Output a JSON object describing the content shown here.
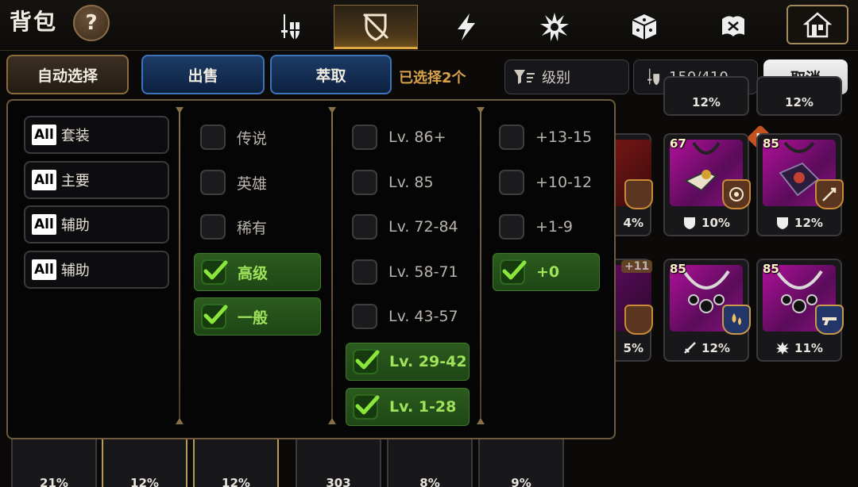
{
  "header": {
    "title": "背包",
    "help_label": "?",
    "tabs": [
      {
        "icon": "sword-shield-icon",
        "active": false
      },
      {
        "icon": "crossed-shield-icon",
        "active": true
      },
      {
        "icon": "lightning-icon",
        "active": false
      },
      {
        "icon": "burst-icon",
        "active": false
      },
      {
        "icon": "dice-icon",
        "active": false
      },
      {
        "icon": "artifact-icon",
        "active": false
      }
    ],
    "home_icon": "house-icon"
  },
  "toolbar": {
    "auto_select": "自动选择",
    "sell": "出售",
    "extract": "萃取",
    "selected_count": "已选择2个",
    "sort_label": "级别",
    "capacity": "150/410",
    "cancel": "取消"
  },
  "filters": {
    "sets": [
      {
        "tag": "All",
        "label": "套装"
      },
      {
        "tag": "All",
        "label": "主要"
      },
      {
        "tag": "All",
        "label": "辅助"
      },
      {
        "tag": "All",
        "label": "辅助"
      }
    ],
    "rarity": [
      {
        "label": "传说",
        "checked": false
      },
      {
        "label": "英雄",
        "checked": false
      },
      {
        "label": "稀有",
        "checked": false
      },
      {
        "label": "高级",
        "checked": true
      },
      {
        "label": "一般",
        "checked": true
      }
    ],
    "level": [
      {
        "label": "Lv. 86+",
        "checked": false
      },
      {
        "label": "Lv. 85",
        "checked": false
      },
      {
        "label": "Lv. 72-84",
        "checked": false
      },
      {
        "label": "Lv. 58-71",
        "checked": false
      },
      {
        "label": "Lv. 43-57",
        "checked": false
      },
      {
        "label": "Lv. 29-42",
        "checked": true
      },
      {
        "label": "Lv. 1-28",
        "checked": true
      }
    ],
    "enhance": [
      {
        "label": "+13-15",
        "checked": false
      },
      {
        "label": "+10-12",
        "checked": false
      },
      {
        "label": "+1-9",
        "checked": false
      },
      {
        "label": "+0",
        "checked": true
      }
    ]
  },
  "inventory": {
    "items": [
      {
        "level": "67",
        "stat": "10%",
        "stat_icon": "shield-icon"
      },
      {
        "level": "85",
        "stat": "12%",
        "stat_icon": "shield-icon",
        "new_badge": "N"
      },
      {
        "level": "85",
        "stat": "12%",
        "stat_icon": "sword-icon"
      },
      {
        "level": "85",
        "stat": "11%",
        "stat_icon": "burst-icon"
      }
    ],
    "partial": [
      {
        "label": "4%"
      },
      {
        "label": "+11"
      },
      {
        "label": "5%"
      },
      {
        "label": "21%"
      },
      {
        "label": "12%"
      },
      {
        "label": "12%"
      },
      {
        "label": "303"
      },
      {
        "label": "8%"
      },
      {
        "label": "9%"
      },
      {
        "label": "12%"
      },
      {
        "label": "12%"
      }
    ]
  },
  "colors": {
    "accent_gold": "#d8a24a",
    "check_green": "#9fe35a",
    "epic_purple": "#b0109a"
  }
}
